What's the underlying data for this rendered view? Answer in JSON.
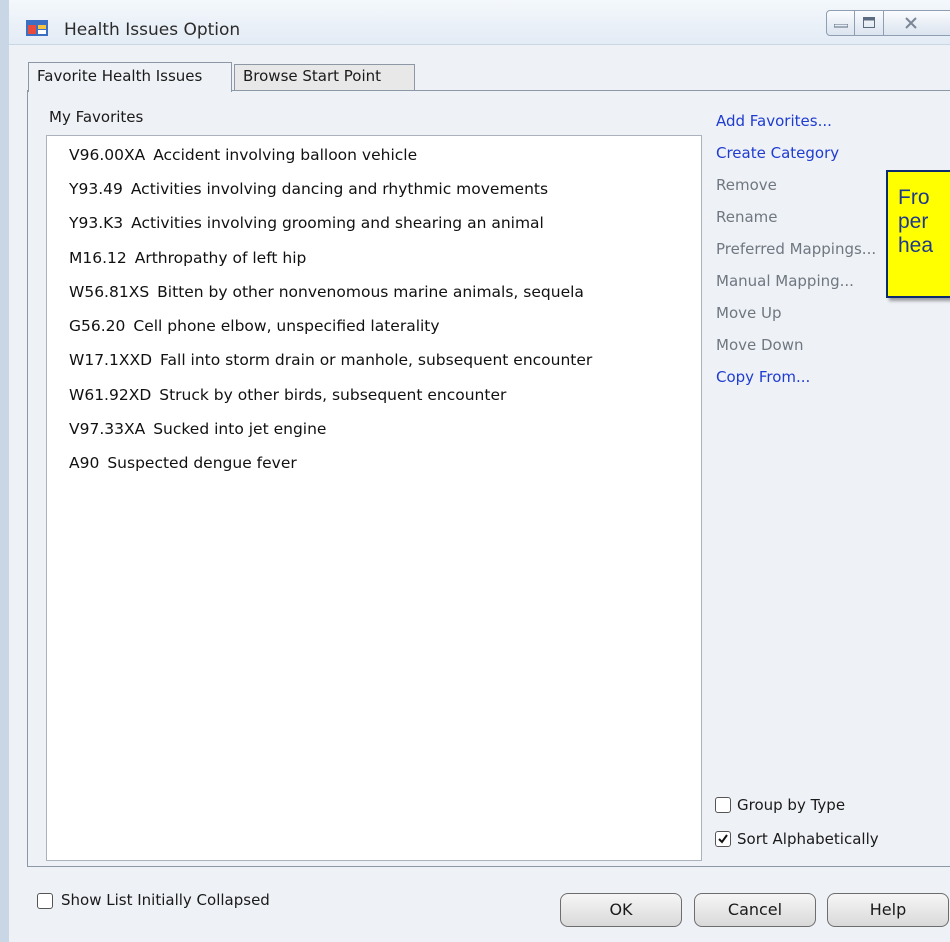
{
  "window": {
    "title": "Health Issues Option"
  },
  "tabs": [
    {
      "label": "Favorite Health Issues",
      "active": true
    },
    {
      "label": "Browse Start Point",
      "active": false
    }
  ],
  "favorites": {
    "label": "My Favorites",
    "items": [
      {
        "code": "V96.00XA",
        "desc": "Accident involving balloon vehicle"
      },
      {
        "code": "Y93.49",
        "desc": "Activities involving dancing and rhythmic movements"
      },
      {
        "code": "Y93.K3",
        "desc": "Activities involving grooming and shearing an animal"
      },
      {
        "code": "M16.12",
        "desc": "Arthropathy of left hip"
      },
      {
        "code": "W56.81XS",
        "desc": "Bitten by other nonvenomous marine animals, sequela"
      },
      {
        "code": "G56.20",
        "desc": "Cell phone elbow, unspecified laterality"
      },
      {
        "code": "W17.1XXD",
        "desc": "Fall into storm drain or manhole, subsequent encounter"
      },
      {
        "code": "W61.92XD",
        "desc": "Struck by other birds, subsequent encounter"
      },
      {
        "code": "V97.33XA",
        "desc": "Sucked into jet engine"
      },
      {
        "code": "A90",
        "desc": "Suspected dengue fever"
      }
    ]
  },
  "actions": [
    {
      "label": "Add Favorites...",
      "enabled": true
    },
    {
      "label": "Create Category",
      "enabled": true
    },
    {
      "label": "Remove",
      "enabled": false
    },
    {
      "label": "Rename",
      "enabled": false
    },
    {
      "label": "Preferred Mappings...",
      "enabled": false
    },
    {
      "label": "Manual Mapping...",
      "enabled": false
    },
    {
      "label": "Move Up",
      "enabled": false
    },
    {
      "label": "Move Down",
      "enabled": false
    },
    {
      "label": "Copy From...",
      "enabled": true
    }
  ],
  "callout": {
    "lines": [
      "Fro",
      "per",
      "hea"
    ]
  },
  "options": {
    "group_by_type": {
      "label": "Group by Type",
      "checked": false
    },
    "sort_alphabetically": {
      "label": "Sort Alphabetically",
      "checked": true
    },
    "show_list_collapsed": {
      "label": "Show List Initially Collapsed",
      "checked": false
    }
  },
  "buttons": {
    "ok": "OK",
    "cancel": "Cancel",
    "help": "Help"
  },
  "colors": {
    "link_enabled": "#1f3cd1",
    "link_disabled": "#6f7780",
    "callout_bg": "#ffff00",
    "callout_border": "#0b2a70"
  }
}
